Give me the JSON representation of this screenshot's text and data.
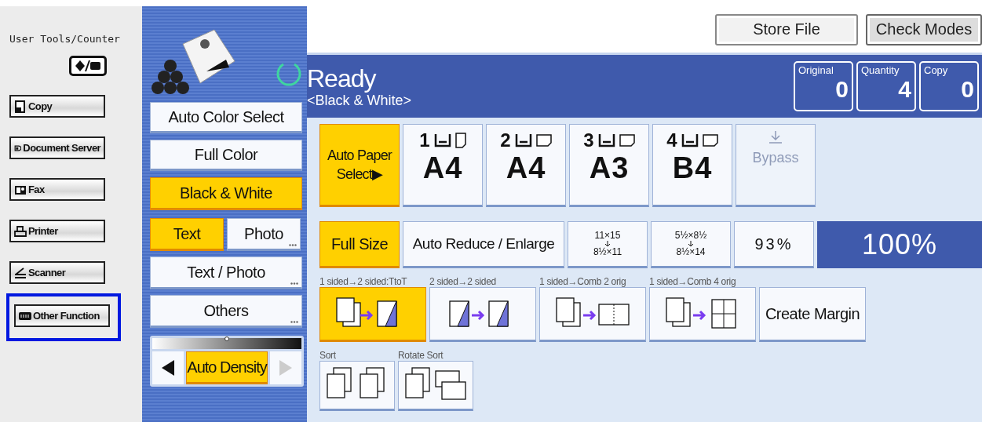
{
  "sidebar": {
    "title": "User Tools/Counter",
    "items": [
      {
        "label": "Copy",
        "kind": "copy",
        "highlighted": false
      },
      {
        "label": "Document Server",
        "kind": "server",
        "highlighted": false
      },
      {
        "label": "Fax",
        "kind": "fax",
        "highlighted": false
      },
      {
        "label": "Printer",
        "kind": "printer",
        "highlighted": false
      },
      {
        "label": "Scanner",
        "kind": "scanner",
        "highlighted": false
      },
      {
        "label": "Other Function",
        "kind": "other",
        "highlighted": true
      }
    ]
  },
  "top_buttons": [
    "Store File",
    "Check Modes"
  ],
  "status": {
    "title": "Ready",
    "subtitle": "<Black & White>"
  },
  "counters": [
    {
      "label": "Original",
      "value": "0"
    },
    {
      "label": "Quantity",
      "value": "4"
    },
    {
      "label": "Copy",
      "value": "0"
    }
  ],
  "color_modes": [
    {
      "label": "Auto Color Select",
      "selected": false
    },
    {
      "label": "Full Color",
      "selected": false
    },
    {
      "label": "Black & White",
      "selected": true
    }
  ],
  "original_types": [
    {
      "label": "Text",
      "selected": true,
      "more": false
    },
    {
      "label": "Photo",
      "selected": false,
      "more": true
    },
    {
      "label": "Text / Photo",
      "selected": false,
      "more": true
    },
    {
      "label": "Others",
      "selected": false,
      "more": true
    }
  ],
  "density": {
    "label": "Auto Density",
    "selected": true,
    "level": 0.5
  },
  "paper": {
    "auto": {
      "label": "Auto Paper Select▶",
      "selected": true
    },
    "trays": [
      {
        "number": "1",
        "size": "A4",
        "kind": "portrait"
      },
      {
        "number": "2",
        "size": "A4",
        "kind": "landscape"
      },
      {
        "number": "3",
        "size": "A3",
        "kind": "landscape"
      },
      {
        "number": "4",
        "size": "B4",
        "kind": "landscape"
      }
    ],
    "bypass": {
      "label": "Bypass",
      "disabled": true
    }
  },
  "ratio": {
    "full": {
      "label": "Full Size",
      "selected": true
    },
    "auto": "Auto Reduce / Enlarge",
    "presets": [
      {
        "from": "11×15",
        "to": "8½×11"
      },
      {
        "from": "5½×8½",
        "to": "8½×14"
      }
    ],
    "percent": "93%",
    "display": "100%"
  },
  "duplex": [
    {
      "caption": "1 sided→2 sided:TtoT",
      "kind": "one-two",
      "selected": true
    },
    {
      "caption": "2 sided→2 sided",
      "kind": "two-two",
      "selected": false
    },
    {
      "caption": "1 sided→Comb 2 orig",
      "kind": "comb2",
      "selected": false
    },
    {
      "caption": "1 sided→Comb 4 orig",
      "kind": "comb4",
      "selected": false
    },
    {
      "kind": "text",
      "label": "Create Margin",
      "selected": false
    }
  ],
  "finishing": [
    {
      "caption": "Sort",
      "kind": "sort",
      "selected": false
    },
    {
      "caption": "Rotate Sort",
      "kind": "rotate",
      "selected": false
    }
  ]
}
